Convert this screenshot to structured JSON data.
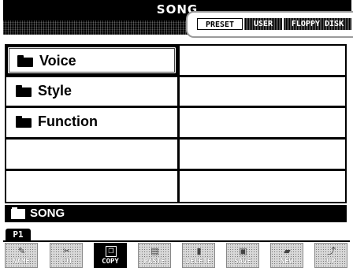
{
  "header": {
    "title": "SONG",
    "tabs": [
      {
        "label": "PRESET",
        "active": true
      },
      {
        "label": "USER",
        "active": false
      },
      {
        "label": "FLOPPY DISK",
        "active": false
      }
    ]
  },
  "files": {
    "left_column": [
      {
        "label": "Voice",
        "icon": "folder-icon",
        "selected": true
      },
      {
        "label": "Style",
        "icon": "folder-icon",
        "selected": false
      },
      {
        "label": "Function",
        "icon": "folder-icon",
        "selected": false
      }
    ]
  },
  "path": {
    "label": "SONG",
    "icon": "folder-icon"
  },
  "page": {
    "label": "P1"
  },
  "buttons": [
    {
      "label": "NAME",
      "icon": "name-icon",
      "active": false
    },
    {
      "label": "CUT",
      "icon": "cut-icon",
      "active": false
    },
    {
      "label": "COPY",
      "icon": "copy-icon",
      "active": true
    },
    {
      "label": "PASTE",
      "icon": "paste-icon",
      "active": false
    },
    {
      "label": "DELETE",
      "icon": "delete-icon",
      "active": false
    },
    {
      "label": "SAVE",
      "icon": "save-icon",
      "active": false
    },
    {
      "label": "NEW",
      "icon": "new-folder-icon",
      "active": false
    },
    {
      "label": "UP",
      "icon": "up-icon",
      "active": false
    }
  ],
  "colors": {
    "foreground": "#000000",
    "background": "#ffffff",
    "button_inactive": "#d8d8d8"
  }
}
